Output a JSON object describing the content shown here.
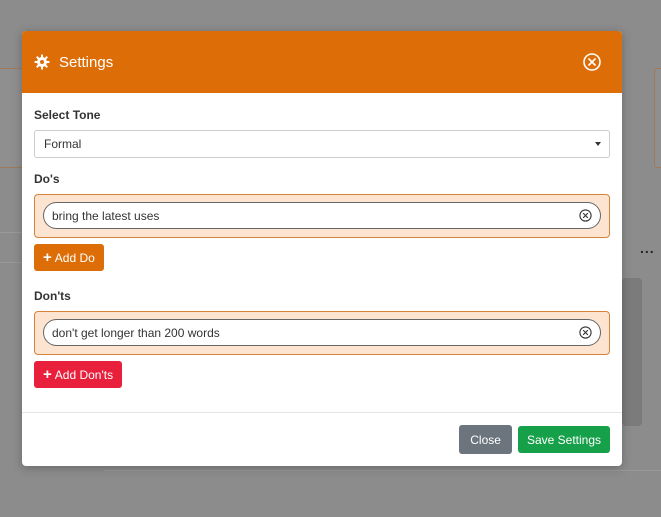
{
  "modal": {
    "title": "Settings",
    "header_icon": "gear-icon",
    "close_icon": "close-circle-icon"
  },
  "tone": {
    "label": "Select Tone",
    "selected": "Formal"
  },
  "dos": {
    "label": "Do's",
    "items": [
      "bring the latest uses"
    ],
    "add_label": "Add Do"
  },
  "donts": {
    "label": "Don'ts",
    "items": [
      "don't get longer than 200 words"
    ],
    "add_label": "Add Don'ts"
  },
  "footer": {
    "close_label": "Close",
    "save_label": "Save Settings"
  },
  "colors": {
    "header": "#dd6e07",
    "add_do": "#dd6e07",
    "add_dont": "#e8203c",
    "close": "#6c757d",
    "save": "#17a04a",
    "rule_bg": "#fde4d0"
  },
  "background": {
    "menu_dots": "..."
  }
}
